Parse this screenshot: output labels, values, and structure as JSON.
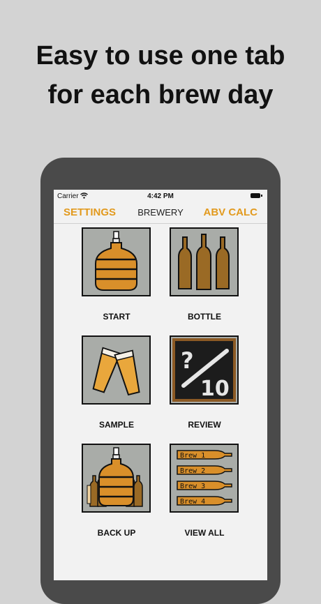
{
  "headline": {
    "line1": "Easy to use one tab",
    "line2": "for each brew day"
  },
  "statusbar": {
    "carrier": "Carrier",
    "time": "4:42 PM"
  },
  "navbar": {
    "left": "SETTINGS",
    "title": "BREWERY",
    "right": "ABV CALC"
  },
  "tiles": [
    {
      "label": "START",
      "icon": "carboy-icon"
    },
    {
      "label": "BOTTLE",
      "icon": "bottles-icon"
    },
    {
      "label": "SAMPLE",
      "icon": "beer-glasses-icon"
    },
    {
      "label": "REVIEW",
      "icon": "chalkboard-review-icon",
      "chalk_text": "?/10"
    },
    {
      "label": "BACK UP",
      "icon": "carboy-bottles-icon"
    },
    {
      "label": "VIEW ALL",
      "icon": "brew-list-icon",
      "brews": [
        "Brew 1",
        "Brew 2",
        "Brew 3",
        "Brew 4"
      ]
    }
  ],
  "colors": {
    "accent": "#e29a1e",
    "beer": "#d98f2a",
    "bottle": "#9a6a25",
    "tile_bg": "#a9aca8"
  }
}
